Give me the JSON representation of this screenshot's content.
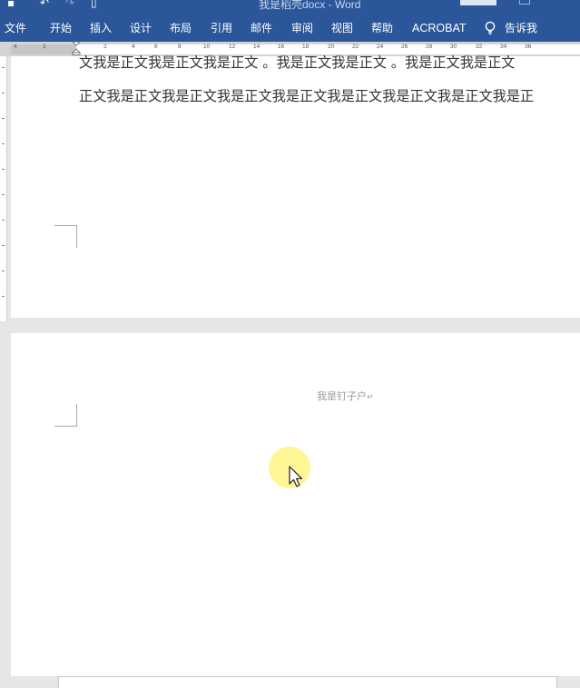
{
  "window": {
    "title": "我是稻壳docx - Word",
    "quick_access": [
      "save-icon",
      "undo-icon",
      "redo-icon",
      "touch-mode-icon"
    ]
  },
  "ribbon": {
    "tabs": [
      {
        "label": "文件",
        "active": false
      },
      {
        "label": "开始",
        "active": false
      },
      {
        "label": "插入",
        "active": false
      },
      {
        "label": "设计",
        "active": false
      },
      {
        "label": "布局",
        "active": false
      },
      {
        "label": "引用",
        "active": false
      },
      {
        "label": "邮件",
        "active": false
      },
      {
        "label": "审阅",
        "active": false
      },
      {
        "label": "视图",
        "active": false
      },
      {
        "label": "帮助",
        "active": false
      },
      {
        "label": "ACROBAT",
        "active": false
      }
    ],
    "tell_me": {
      "icon": "lightbulb-icon",
      "label": "告诉我"
    }
  },
  "ruler": {
    "numbers": [
      "4",
      "2",
      "2",
      "4",
      "6",
      "8",
      "10",
      "12",
      "14",
      "16",
      "18",
      "20",
      "22",
      "24",
      "26",
      "28",
      "30",
      "32",
      "34",
      "36"
    ]
  },
  "document": {
    "page1": {
      "line1": "文我是正文我是正文我是正文 。我是正文我是正文 。我是正文我是正文",
      "line2": "正文我是正文我是正文我是正文我是正文我是正文我是正文我是正文我是正"
    },
    "page2": {
      "footer_text": "我是钉子户",
      "paragraph_mark": "↵"
    }
  },
  "colors": {
    "ribbon_bg": "#2b579a",
    "page_bg": "#ffffff",
    "workspace_bg": "#e6e6e6",
    "cursor_highlight": "#fff58a"
  }
}
